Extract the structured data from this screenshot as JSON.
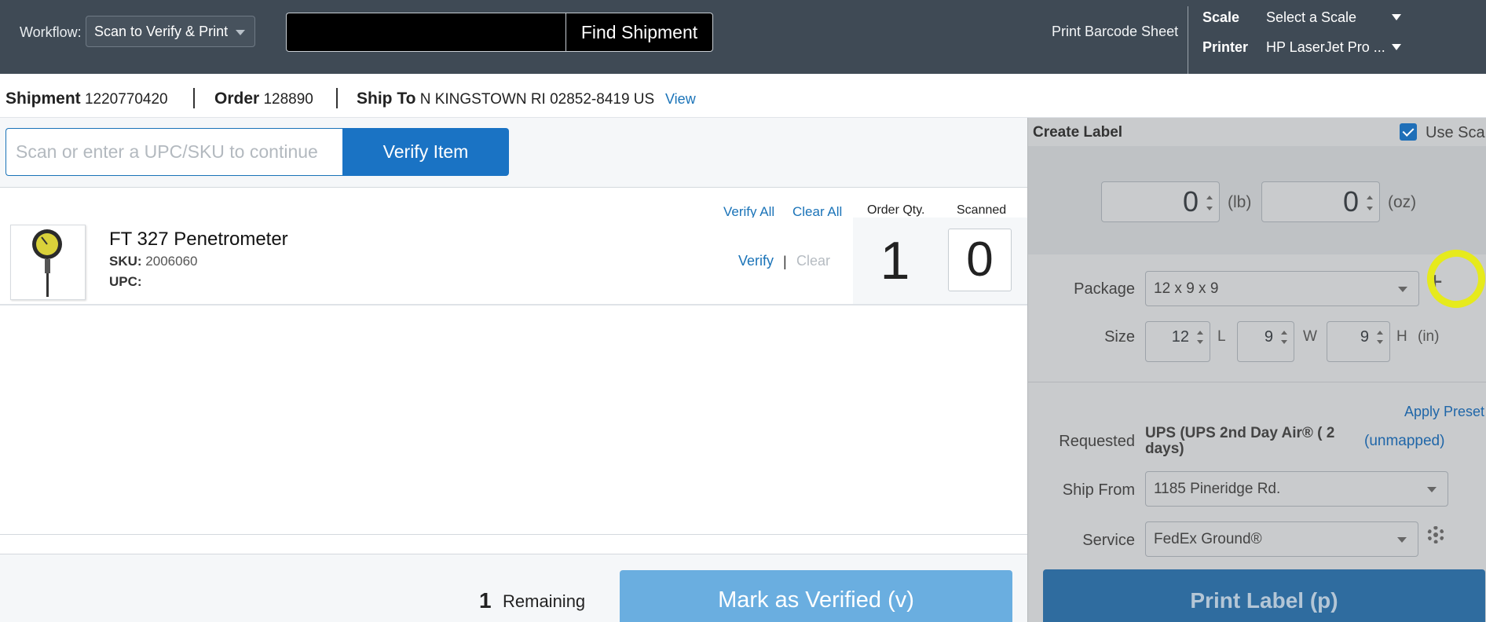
{
  "topbar": {
    "workflow_label": "Workflow:",
    "workflow_value": "Scan to Verify & Print",
    "find_button": "Find Shipment",
    "print_barcode_sheet": "Print Barcode Sheet",
    "scale_label": "Scale",
    "scale_value": "Select a Scale",
    "printer_label": "Printer",
    "printer_value": "HP LaserJet Pro ..."
  },
  "shipment": {
    "shipment_label": "Shipment",
    "shipment_number": "1220770420",
    "order_label": "Order",
    "order_number": "128890",
    "ship_to_label": "Ship To",
    "ship_to_value": "N KINGSTOWN RI 02852-8419 US",
    "view_link": "View"
  },
  "scan": {
    "placeholder": "Scan or enter a UPC/SKU to continue",
    "verify_button": "Verify Item"
  },
  "columns": {
    "verify_all": "Verify All",
    "clear_all": "Clear All",
    "order_qty": "Order Qty.",
    "scanned": "Scanned"
  },
  "items": [
    {
      "name": "FT 327 Penetrometer",
      "sku_label": "SKU:",
      "sku": "2006060",
      "upc_label": "UPC:",
      "upc": "",
      "verify": "Verify",
      "separator": "|",
      "clear": "Clear",
      "order_qty": "1",
      "scanned": "0"
    }
  ],
  "footer": {
    "remaining_count": "1",
    "remaining_label": "Remaining",
    "mark_verified_button": "Mark as Verified (v)"
  },
  "label_panel": {
    "title": "Create Label",
    "use_scale": "Use Sca",
    "weight_lb": "0",
    "unit_lb": "(lb)",
    "weight_oz": "0",
    "unit_oz": "(oz)",
    "package_label": "Package",
    "package_value": "12 x 9 x 9",
    "size_label": "Size",
    "length": "12",
    "length_unit": "L",
    "width": "9",
    "width_unit": "W",
    "height": "9",
    "height_unit": "H",
    "size_unit": "(in)",
    "apply_preset": "Apply Preset",
    "requested_label": "Requested",
    "requested_value": "UPS (UPS 2nd Day Air® ( 2 days)",
    "unmapped": "(unmapped)",
    "ship_from_label": "Ship From",
    "ship_from_value": "1185 Pineridge Rd.",
    "service_label": "Service",
    "service_value": "FedEx Ground®",
    "print_button": "Print Label (p)"
  },
  "colors": {
    "topbar_bg": "#3f4a55",
    "accent_blue": "#1a73c4",
    "mark_verified_bg": "#6aaee0",
    "print_label_bg": "#2f6c9f",
    "annotation_yellow": "#e6ea1c"
  },
  "icons": [
    "caret-down-icon",
    "check-icon",
    "plus-icon",
    "gear-icon",
    "spinner-arrows-icon"
  ]
}
